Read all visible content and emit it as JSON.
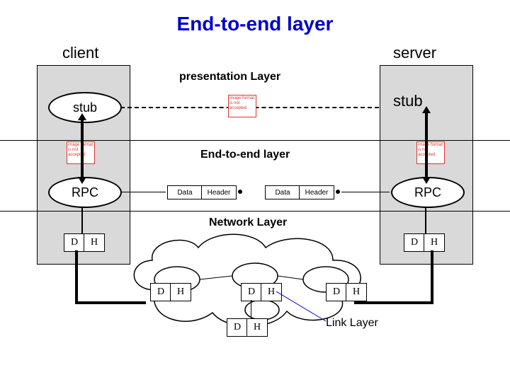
{
  "title": "End-to-end layer",
  "roles": {
    "left": "client",
    "right": "server"
  },
  "layers": {
    "presentation": "presentation Layer",
    "endtoend": "End-to-end layer",
    "network": "Network Layer",
    "link": "Link Layer"
  },
  "stubs": {
    "left": "stub",
    "right": "stub"
  },
  "rpc": {
    "left": "RPC",
    "right": "RPC"
  },
  "packets": {
    "data": "Data",
    "header": "Header"
  },
  "dh": {
    "d": "D",
    "h": "H"
  },
  "placeholder_text": "image format is not accepted"
}
